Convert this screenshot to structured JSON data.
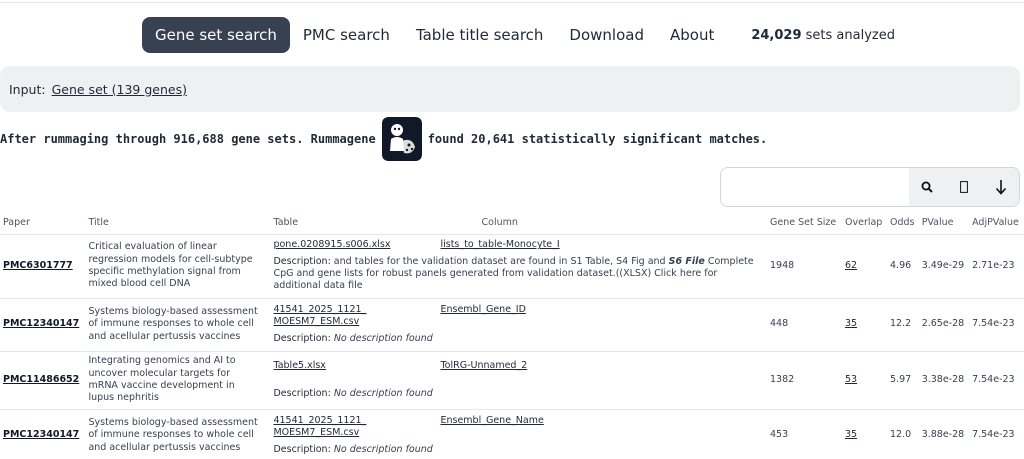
{
  "nav": {
    "items": [
      {
        "label": "Gene set search",
        "active": true
      },
      {
        "label": "PMC search",
        "active": false
      },
      {
        "label": "Table title search",
        "active": false
      },
      {
        "label": "Download",
        "active": false
      },
      {
        "label": "About",
        "active": false
      }
    ],
    "stat_count": "24,029",
    "stat_label": " sets analyzed"
  },
  "input": {
    "label": "Input:",
    "link": "Gene set (139 genes)"
  },
  "summary": {
    "before": "After rummaging through 916,688 gene sets. Rummagene",
    "after": "found 20,641 statistically significant matches."
  },
  "search": {
    "placeholder": "",
    "icons": [
      "search-icon",
      "filter-icon",
      "download-icon"
    ]
  },
  "table": {
    "headers": [
      "Paper",
      "Title",
      "Table",
      "Column",
      "Gene Set Size",
      "Overlap",
      "Odds",
      "PValue",
      "AdjPValue"
    ],
    "rows": [
      {
        "paper": "PMC6301777",
        "title": "Critical evaluation of linear regression models for cell-subtype specific methylation signal from mixed blood cell DNA",
        "table": "pone.0208915.s006.xlsx",
        "column": "lists_to_table-Monocyte_I",
        "desc_label": "Description:",
        "desc_pre": " and tables for the validation dataset are found in S1 Table, S4 Fig and ",
        "desc_em": "S6 File",
        "desc_post": " Complete CpG and gene lists for robust panels generated from validation dataset.((XLSX) Click here for additional data file",
        "size": "1948",
        "overlap": "62",
        "odds": "4.96",
        "pvalue": "3.49e-29",
        "adjp": "2.71e-23"
      },
      {
        "paper": "PMC12340147",
        "title": "Systems biology-based assessment of immune responses to whole cell and acellular pertussis vaccines",
        "table": "41541_2025_1121_MOESM7_ESM.csv",
        "column": "Ensembl_Gene_ID",
        "desc_label": "Description:",
        "desc_none": "No description found",
        "size": "448",
        "overlap": "35",
        "odds": "12.2",
        "pvalue": "2.65e-28",
        "adjp": "7.54e-23"
      },
      {
        "paper": "PMC11486652",
        "title": "Integrating genomics and AI to uncover molecular targets for mRNA vaccine development in lupus nephritis",
        "table": "Table5.xlsx",
        "column": "TolRG-Unnamed_2",
        "desc_label": "Description:",
        "desc_none": "No description found",
        "size": "1382",
        "overlap": "53",
        "odds": "5.97",
        "pvalue": "3.38e-28",
        "adjp": "7.54e-23"
      },
      {
        "paper": "PMC12340147",
        "title": "Systems biology-based assessment of immune responses to whole cell and acellular pertussis vaccines",
        "table": "41541_2025_1121_MOESM7_ESM.csv",
        "column": "Ensembl_Gene_Name",
        "desc_label": "Description:",
        "desc_none": "No description found",
        "size": "453",
        "overlap": "35",
        "odds": "12.0",
        "pvalue": "3.88e-28",
        "adjp": "7.54e-23"
      }
    ]
  }
}
